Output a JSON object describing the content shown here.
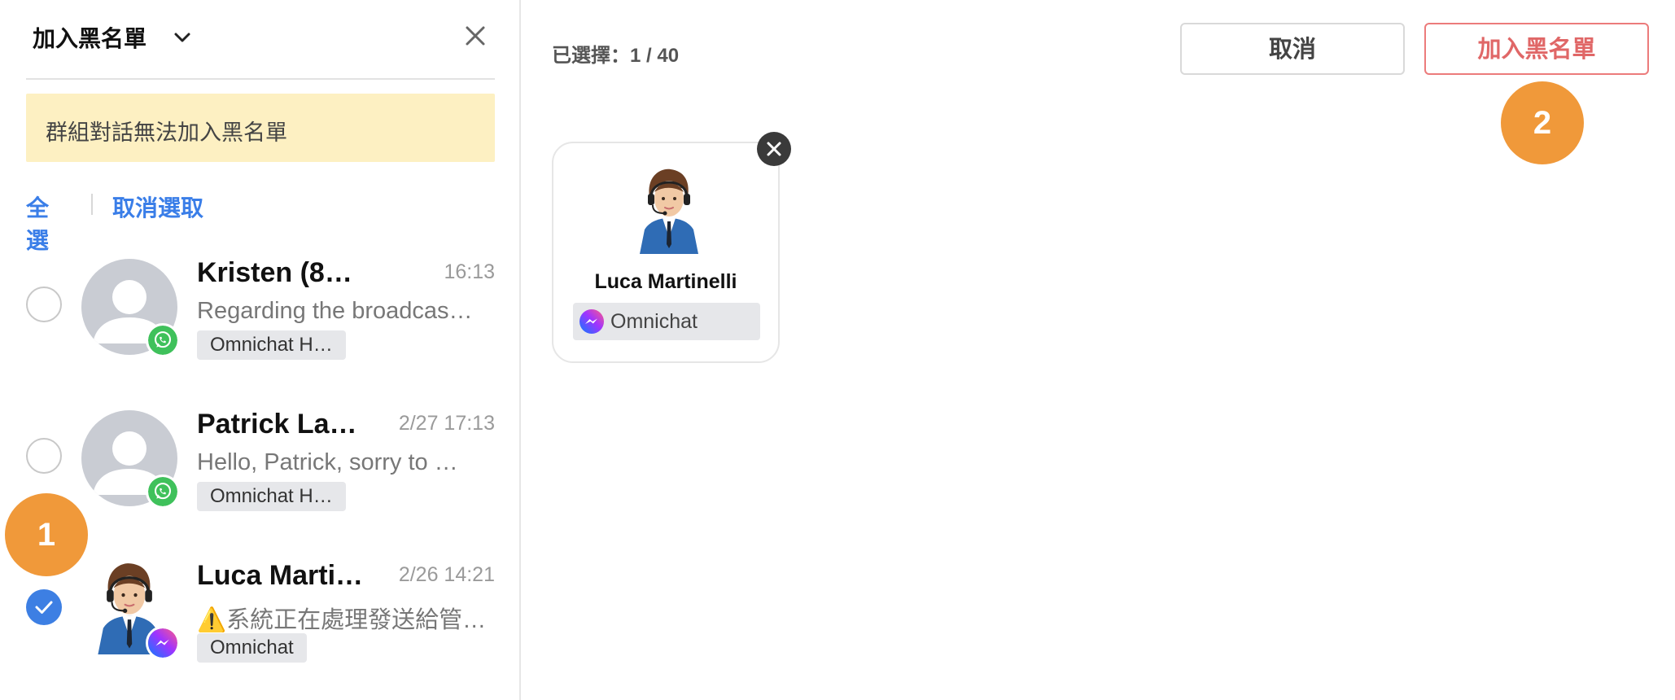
{
  "header": {
    "title": "加入黑名單"
  },
  "warning": {
    "text": "群組對話無法加入黑名單"
  },
  "select_links": {
    "select_all": "全選",
    "deselect": "取消選取"
  },
  "conversations": [
    {
      "name": "Kristen (8…",
      "time": "16:13",
      "preview": "Regarding the broadcas…",
      "tag": "Omnichat H…",
      "channel": "whatsapp-icon",
      "selected": false
    },
    {
      "name": "Patrick La…",
      "time": "2/27 17:13",
      "preview": "Hello, Patrick, sorry to …",
      "tag": "Omnichat H…",
      "channel": "whatsapp-icon",
      "selected": false
    },
    {
      "name": "Luca Marti…",
      "time": "2/26 14:21",
      "preview": "⚠️系統正在處理發送給管…",
      "tag": "Omnichat",
      "channel": "messenger-icon",
      "selected": true
    }
  ],
  "selection": {
    "count_text": "已選擇：1 / 40"
  },
  "actions": {
    "cancel_label": "取消",
    "block_label": "加入黑名單"
  },
  "selected_card": {
    "name": "Luca Martinelli",
    "channel_label": "Omnichat",
    "channel_icon": "messenger-icon"
  },
  "step_badges": {
    "first": "1",
    "second": "2"
  },
  "colors": {
    "accent_blue": "#3a7ee8",
    "danger": "#e06767",
    "step_badge": "#f0993a",
    "warning_bg": "#fdf0c2",
    "whatsapp": "#3fc15b"
  }
}
